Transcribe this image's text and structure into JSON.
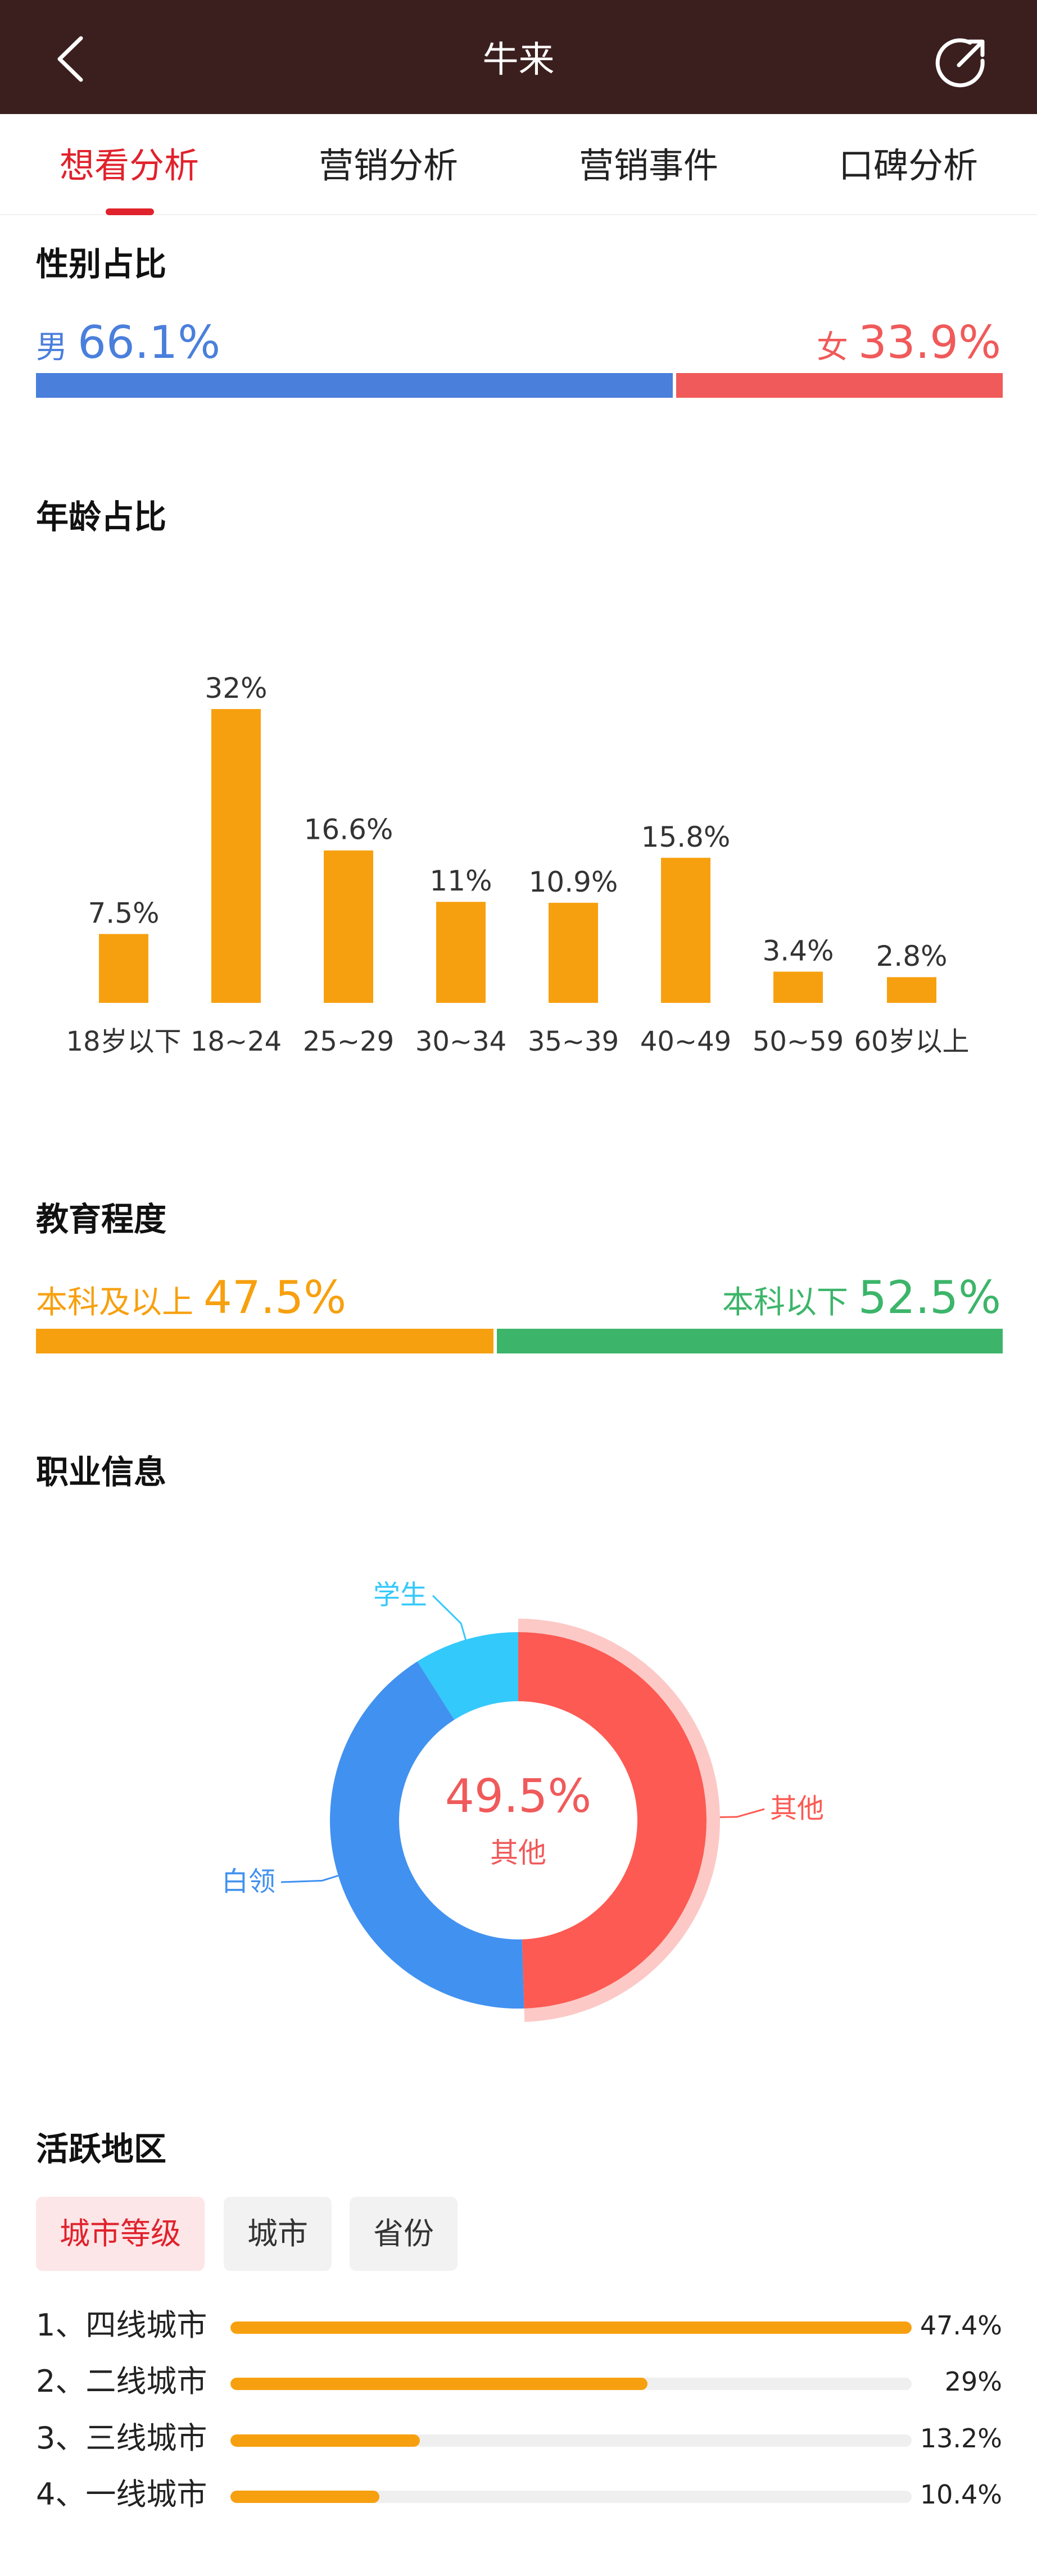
{
  "header": {
    "title": "牛来",
    "back_icon": "chevron-left-icon",
    "share_icon": "share-icon"
  },
  "tabs": [
    {
      "label": "想看分析",
      "active": true
    },
    {
      "label": "营销分析",
      "active": false
    },
    {
      "label": "营销事件",
      "active": false
    },
    {
      "label": "口碑分析",
      "active": false
    }
  ],
  "gender": {
    "title": "性别占比",
    "male_label": "男",
    "male_value": "66.1%",
    "female_label": "女",
    "female_value": "33.9%",
    "male_ratio": 0.661,
    "colors": {
      "male": "#4a7fdc",
      "female": "#f05a5a"
    }
  },
  "age": {
    "title": "年龄占比"
  },
  "chart_data": [
    {
      "type": "bar",
      "categories": [
        "18岁以下",
        "18~24",
        "25~29",
        "30~34",
        "35~39",
        "40~49",
        "50~59",
        "60岁以上"
      ],
      "values": [
        7.5,
        32,
        16.6,
        11,
        10.9,
        15.8,
        3.4,
        2.8
      ],
      "value_labels": [
        "7.5%",
        "32%",
        "16.6%",
        "11%",
        "10.9%",
        "15.8%",
        "3.4%",
        "2.8%"
      ],
      "color": "#f7a00f",
      "ylim": [
        0,
        32
      ],
      "grid": false
    },
    {
      "type": "pie",
      "categories": [
        "其他",
        "白领",
        "学生"
      ],
      "values": [
        49.5,
        41.5,
        9.0
      ],
      "colors": [
        "#fc5a53",
        "#4191f0",
        "#34c9fb"
      ],
      "center_value": "49.5%",
      "center_label": "其他",
      "highlighted": "其他"
    }
  ],
  "education": {
    "title": "教育程度",
    "left_label": "本科及以上",
    "left_value": "47.5%",
    "right_label": "本科以下",
    "right_value": "52.5%",
    "left_ratio": 0.475,
    "colors": {
      "left": "#f7a00f",
      "right": "#3cb56a"
    }
  },
  "job": {
    "title": "职业信息"
  },
  "region": {
    "title": "活跃地区",
    "filters": [
      {
        "label": "城市等级",
        "active": true
      },
      {
        "label": "城市",
        "active": false
      },
      {
        "label": "省份",
        "active": false
      }
    ],
    "rows": [
      {
        "name": "1、四线城市",
        "value": "47.4%",
        "ratio": 1.0
      },
      {
        "name": "2、二线城市",
        "value": "29%",
        "ratio": 0.612
      },
      {
        "name": "3、三线城市",
        "value": "13.2%",
        "ratio": 0.278
      },
      {
        "name": "4、一线城市",
        "value": "10.4%",
        "ratio": 0.219
      }
    ]
  }
}
